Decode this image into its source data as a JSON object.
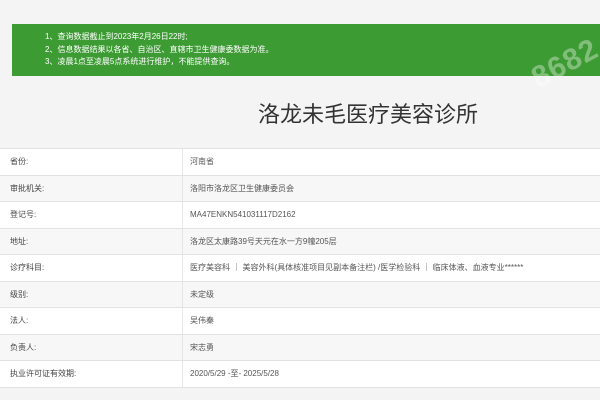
{
  "notice": {
    "lines": [
      "1、查询数据截止到2023年2月26日22时;",
      "2、信息数据结果以各省、自治区、直辖市卫生健康委数据为准。",
      "3、凌晨1点至凌晨5点系统进行维护，不能提供查询。"
    ]
  },
  "watermark": "8682",
  "title": "洛龙未毛医疗美容诊所",
  "rows": [
    {
      "label": "省份:",
      "value": "河南省"
    },
    {
      "label": "审批机关:",
      "value": "洛阳市洛龙区卫生健康委员会"
    },
    {
      "label": "登记号:",
      "value": "MA47ENKN541031117D2162"
    },
    {
      "label": "地址:",
      "value": "洛龙区太康路39号天元在水一方9幢205层"
    },
    {
      "label": "诊疗科目:",
      "value": "医疗美容科 ｜ 美容外科(具体核准项目见副本备注栏) /医学检验科 ｜ 临床体液、血液专业******"
    },
    {
      "label": "级别:",
      "value": "未定级"
    },
    {
      "label": "法人:",
      "value": "吴伟秦"
    },
    {
      "label": "负责人:",
      "value": "宋志勇"
    },
    {
      "label": "执业许可证有效期:",
      "value": "2020/5/29 -至- 2025/5/28"
    }
  ]
}
